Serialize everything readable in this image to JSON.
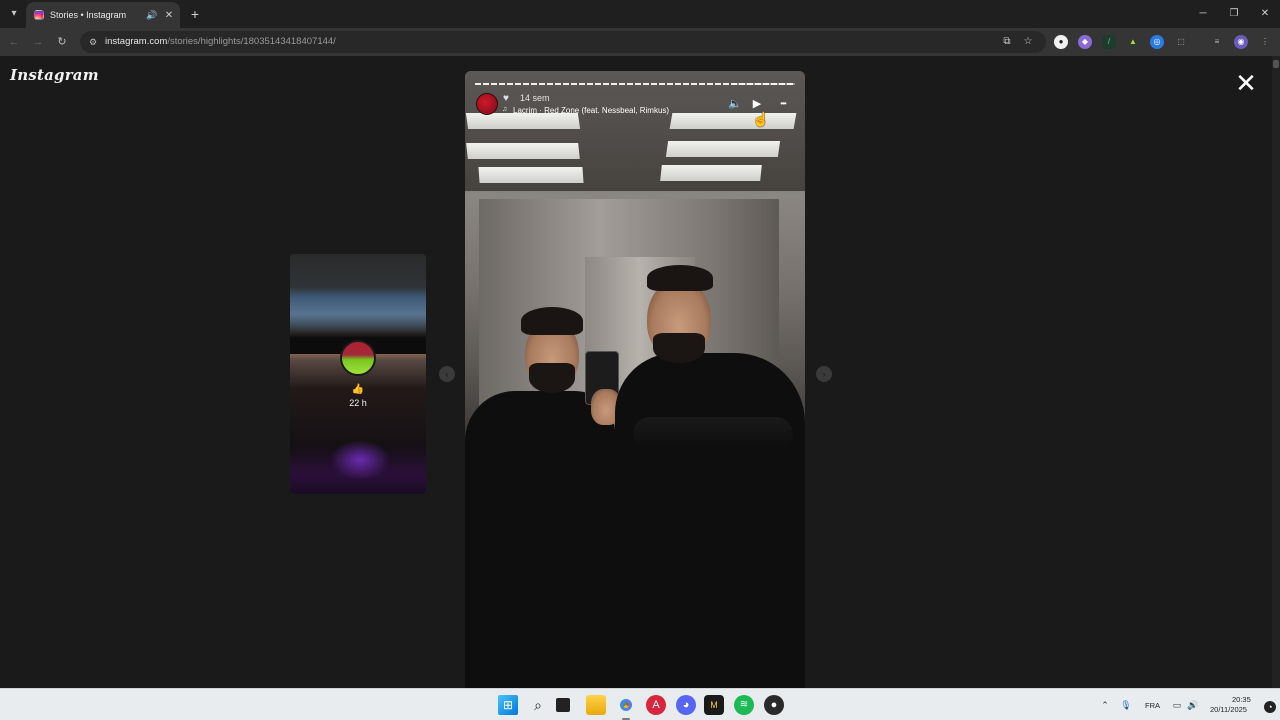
{
  "browser": {
    "tab": {
      "title": "Stories • Instagram",
      "audio_icon": "speaker-icon",
      "close_glyph": "✕"
    },
    "new_tab_glyph": "+",
    "window_controls": {
      "minimize": "─",
      "maximize": "❐",
      "close": "✕"
    },
    "url": {
      "host": "instagram.com",
      "path": "/stories/highlights/18035143418407144/"
    }
  },
  "page": {
    "logo": "Instagram",
    "close_glyph": "✕",
    "preview_story": {
      "emoji": "👍",
      "time": "22 h"
    },
    "prev_arrow": "‹",
    "next_arrow": "›",
    "story": {
      "time": "14 sem",
      "music": "Lacrim · Red Zone (feat. Nessbeal, Rimkus)",
      "controls": {
        "mute": "🔈",
        "play": "▶",
        "more": "•••"
      }
    }
  },
  "taskbar": {
    "tray": {
      "language": "FRA",
      "time": "20:35",
      "date": "20/11/2025"
    }
  },
  "colors": {
    "background": "#1a1a1a",
    "taskbar": "#e8ecef",
    "windows_blue": "#0078d4",
    "chrome_toolbar": "#353535"
  }
}
